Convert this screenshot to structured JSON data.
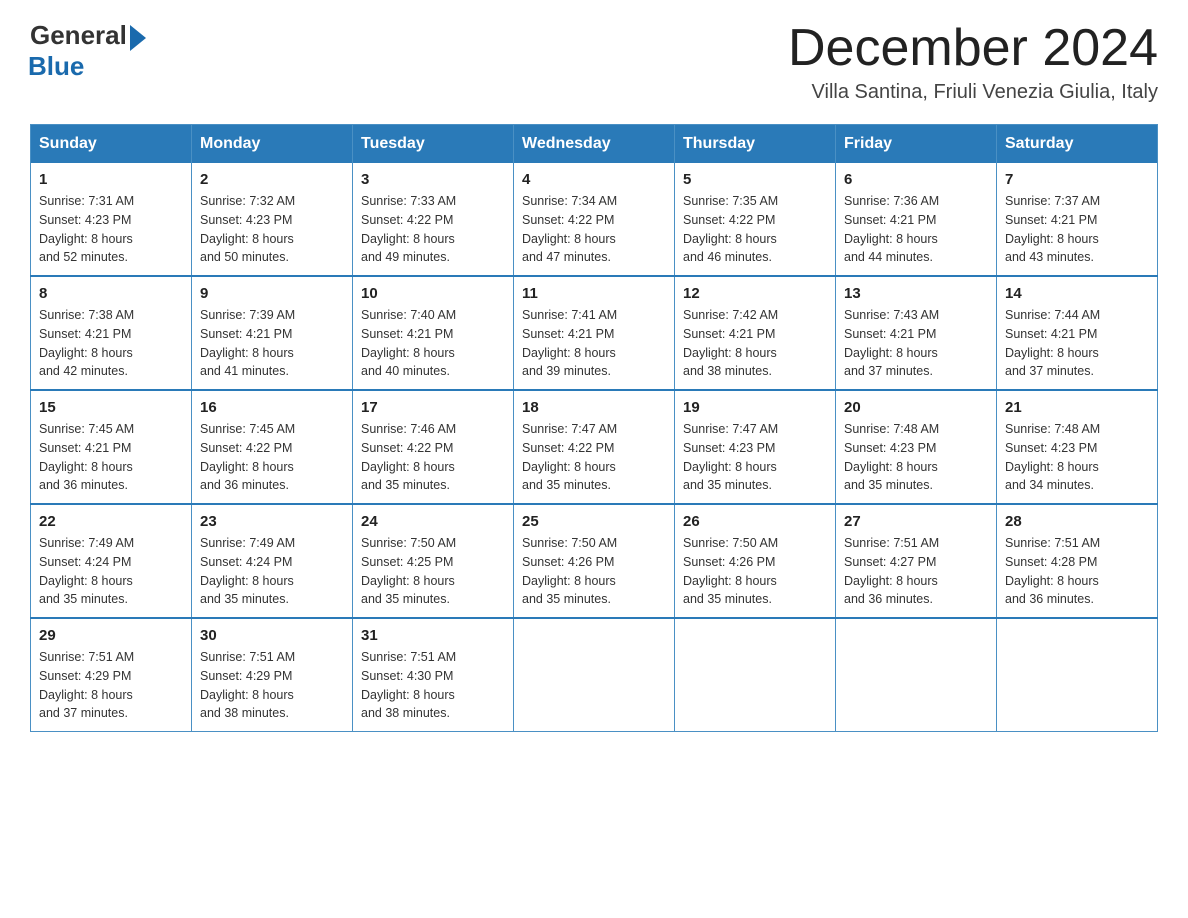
{
  "header": {
    "logo_general": "General",
    "logo_blue": "Blue",
    "month_title": "December 2024",
    "subtitle": "Villa Santina, Friuli Venezia Giulia, Italy"
  },
  "weekdays": [
    "Sunday",
    "Monday",
    "Tuesday",
    "Wednesday",
    "Thursday",
    "Friday",
    "Saturday"
  ],
  "weeks": [
    [
      {
        "day": "1",
        "sunrise": "7:31 AM",
        "sunset": "4:23 PM",
        "daylight": "8 hours and 52 minutes."
      },
      {
        "day": "2",
        "sunrise": "7:32 AM",
        "sunset": "4:23 PM",
        "daylight": "8 hours and 50 minutes."
      },
      {
        "day": "3",
        "sunrise": "7:33 AM",
        "sunset": "4:22 PM",
        "daylight": "8 hours and 49 minutes."
      },
      {
        "day": "4",
        "sunrise": "7:34 AM",
        "sunset": "4:22 PM",
        "daylight": "8 hours and 47 minutes."
      },
      {
        "day": "5",
        "sunrise": "7:35 AM",
        "sunset": "4:22 PM",
        "daylight": "8 hours and 46 minutes."
      },
      {
        "day": "6",
        "sunrise": "7:36 AM",
        "sunset": "4:21 PM",
        "daylight": "8 hours and 44 minutes."
      },
      {
        "day": "7",
        "sunrise": "7:37 AM",
        "sunset": "4:21 PM",
        "daylight": "8 hours and 43 minutes."
      }
    ],
    [
      {
        "day": "8",
        "sunrise": "7:38 AM",
        "sunset": "4:21 PM",
        "daylight": "8 hours and 42 minutes."
      },
      {
        "day": "9",
        "sunrise": "7:39 AM",
        "sunset": "4:21 PM",
        "daylight": "8 hours and 41 minutes."
      },
      {
        "day": "10",
        "sunrise": "7:40 AM",
        "sunset": "4:21 PM",
        "daylight": "8 hours and 40 minutes."
      },
      {
        "day": "11",
        "sunrise": "7:41 AM",
        "sunset": "4:21 PM",
        "daylight": "8 hours and 39 minutes."
      },
      {
        "day": "12",
        "sunrise": "7:42 AM",
        "sunset": "4:21 PM",
        "daylight": "8 hours and 38 minutes."
      },
      {
        "day": "13",
        "sunrise": "7:43 AM",
        "sunset": "4:21 PM",
        "daylight": "8 hours and 37 minutes."
      },
      {
        "day": "14",
        "sunrise": "7:44 AM",
        "sunset": "4:21 PM",
        "daylight": "8 hours and 37 minutes."
      }
    ],
    [
      {
        "day": "15",
        "sunrise": "7:45 AM",
        "sunset": "4:21 PM",
        "daylight": "8 hours and 36 minutes."
      },
      {
        "day": "16",
        "sunrise": "7:45 AM",
        "sunset": "4:22 PM",
        "daylight": "8 hours and 36 minutes."
      },
      {
        "day": "17",
        "sunrise": "7:46 AM",
        "sunset": "4:22 PM",
        "daylight": "8 hours and 35 minutes."
      },
      {
        "day": "18",
        "sunrise": "7:47 AM",
        "sunset": "4:22 PM",
        "daylight": "8 hours and 35 minutes."
      },
      {
        "day": "19",
        "sunrise": "7:47 AM",
        "sunset": "4:23 PM",
        "daylight": "8 hours and 35 minutes."
      },
      {
        "day": "20",
        "sunrise": "7:48 AM",
        "sunset": "4:23 PM",
        "daylight": "8 hours and 35 minutes."
      },
      {
        "day": "21",
        "sunrise": "7:48 AM",
        "sunset": "4:23 PM",
        "daylight": "8 hours and 34 minutes."
      }
    ],
    [
      {
        "day": "22",
        "sunrise": "7:49 AM",
        "sunset": "4:24 PM",
        "daylight": "8 hours and 35 minutes."
      },
      {
        "day": "23",
        "sunrise": "7:49 AM",
        "sunset": "4:24 PM",
        "daylight": "8 hours and 35 minutes."
      },
      {
        "day": "24",
        "sunrise": "7:50 AM",
        "sunset": "4:25 PM",
        "daylight": "8 hours and 35 minutes."
      },
      {
        "day": "25",
        "sunrise": "7:50 AM",
        "sunset": "4:26 PM",
        "daylight": "8 hours and 35 minutes."
      },
      {
        "day": "26",
        "sunrise": "7:50 AM",
        "sunset": "4:26 PM",
        "daylight": "8 hours and 35 minutes."
      },
      {
        "day": "27",
        "sunrise": "7:51 AM",
        "sunset": "4:27 PM",
        "daylight": "8 hours and 36 minutes."
      },
      {
        "day": "28",
        "sunrise": "7:51 AM",
        "sunset": "4:28 PM",
        "daylight": "8 hours and 36 minutes."
      }
    ],
    [
      {
        "day": "29",
        "sunrise": "7:51 AM",
        "sunset": "4:29 PM",
        "daylight": "8 hours and 37 minutes."
      },
      {
        "day": "30",
        "sunrise": "7:51 AM",
        "sunset": "4:29 PM",
        "daylight": "8 hours and 38 minutes."
      },
      {
        "day": "31",
        "sunrise": "7:51 AM",
        "sunset": "4:30 PM",
        "daylight": "8 hours and 38 minutes."
      },
      null,
      null,
      null,
      null
    ]
  ],
  "labels": {
    "sunrise": "Sunrise:",
    "sunset": "Sunset:",
    "daylight": "Daylight:"
  }
}
